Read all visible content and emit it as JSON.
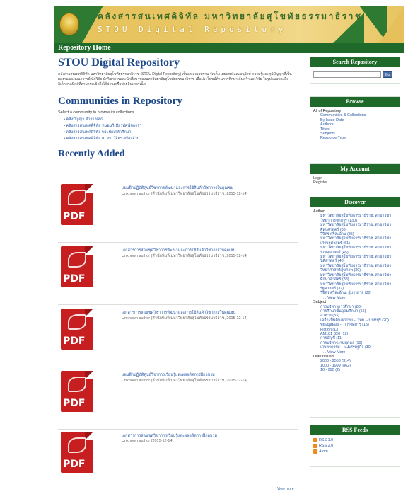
{
  "header": {
    "thai_title": "คลังสารสนเทศดิจิทัล มหาวิทยาลัยสุโขทัยธรรมาธิราช",
    "english_title": "STOU Digital Repository",
    "nav_home": "Repository Home"
  },
  "main": {
    "title": "STOU Digital Repository",
    "intro": "คลังสารสนเทศดิจิทัล มหาวิทยาลัยสุโขทัยธรรมาธิราช (STOU Digital Repository) เป็นแหล่งรวบรวม จัดเก็บ เผยแพร่ และอนุรักษ์ ความรู้และภูมิปัญญาที่เป็นผลงานของคณาจารย์ นักวิจัย นักวิชาการและนักศึกษาของมหาวิทยาลัยสุโขทัยธรรมาธิราช เพื่อประโยชน์ด้านการศึกษา ค้นคว้าและวิจัย ในรูปแบบของสื่ออิเล็กทรอนิกส์ที่สามารถเข้าถึงได้ผ่านเครือข่ายอินเทอร์เน็ต",
    "communities_title": "Communities in Repository",
    "communities_note": "Select a community to browse its collections.",
    "communities": [
      "คลังปัญญา ตำรา มสธ.",
      "คลังสารสนเทศดิจิทัล หนอนวิเทียรทัศน์ของรา",
      "คลังสารสนเทศดิจิทัล พระปกเกล้าศึกษา",
      "คลังสารสนเทศดิจิทัล ศ. ดร. วิจิตร ศรีสะอ้าน"
    ],
    "recent_title": "Recently Added",
    "recent": [
      {
        "title": "แผนฝึกปฏิบัติศูนย์วิชาการพัฒนาและการใช้สินค้าวิชาการในคุณชน",
        "author": "Unknown author (สำนักพิมพ์ มหาวิทยาลัยสุโขทัยธรรมาธิราช, 2015-12-14)"
      },
      {
        "title": "เอกสารการสอนชุดวิชาการพัฒนาและการใช้สินค้าวิชาการในคุณชน",
        "author": "Unknown author (สำนักพิมพ์ มหาวิทยาลัยสุโขทัยธรรมาธิราช, 2015-12-14)"
      },
      {
        "title": "เอกสารการสอนชุดวิชาการพัฒนาและการใช้สินค้าวิชาการในคุณชน",
        "author": "Unknown author (สำนักพิมพ์ มหาวิทยาลัยสุโขทัยธรรมาธิราช, 2015-12-14)"
      },
      {
        "title": "แผนฝึกปฏิบัติศูนย์วิชาการเรียนรู้และผลผลิตการฝึกอบรม",
        "author": "Unknown author (สำนักพิมพ์ มหาวิทยาลัยสุโขทัยธรรมาธิราช, 2015-12-14)"
      },
      {
        "title": "เอกสารการสอนชุดวิชาการเรียนรู้และผลผลิตการฝึกอบรม",
        "author": "Unknown author (2015-12-14)"
      }
    ],
    "pdf_label": "PDF",
    "view_more": "View more"
  },
  "sidebar": {
    "search_title": "Search Repository",
    "search_button": "Go",
    "browse_title": "Browse",
    "browse_root": "All of Repository",
    "browse_items": [
      "Communities & Collections",
      "By Issue Date",
      "Authors",
      "Titles",
      "Subjects",
      "Resource Type"
    ],
    "account_title": "My Account",
    "account_items": [
      "Login",
      "Register"
    ],
    "discover_title": "Discover",
    "author_label": "Author",
    "authors": [
      "มหาวิทยาลัยสุโขทัยธรรมาธิราช. สาขาวิชาวิทยาการจัดการ (130)",
      "มหาวิทยาลัยสุโขทัยธรรมาธิราช. สาขาวิชาศิลปศาสตร์ (86)",
      "วิจิตร ศรีสะอ้าน (85)",
      "มหาวิทยาลัยสุโขทัยธรรมาธิราช. สาขาวิชาเศรษฐศาสตร์ (61)",
      "มหาวิทยาลัยสุโขทัยธรรมาธิราช. สาขาวิชานิเทศศาสตร์ (45)",
      "มหาวิทยาลัยสุโขทัยธรรมาธิราช. สาขาวิชานิติศาสตร์ (40)",
      "มหาวิทยาลัยสุโขทัยธรรมาธิราช. สาขาวิชาวิทยาศาสตร์สุขภาพ (39)",
      "มหาวิทยาลัยสุโขทัยธรรมาธิราช. สาขาวิชาศึกษาศาสตร์ (38)",
      "มหาวิทยาลัยสุโขทัยธรรมาธิราช. สาขาวิชารัฐศาสตร์ (37)",
      "วิจิตร ศรีสะอ้าน, ผู้บรรยาย (30)"
    ],
    "subject_label": "Subject",
    "subjects": [
      "การบริหารการศึกษา (88)",
      "การศึกษาขั้นอุดมศึกษา (56)",
      "อาหาร (33)",
      "เครื่องปั้นดินเผาไทย -- ไทย -- นนทบุรี (20)",
      "ขยะมูลฝอย -- การจัดการ (15)",
      "Fiction (13)",
      "AM181 B26 (12)",
      "การบัญชี (11)",
      "การบริหารงานบุคคล (10)",
      "เกษตรกรรม -- แง่เศรษฐกิจ (10)"
    ],
    "date_label": "Date Issued",
    "dates": [
      "2000 - 2558 (314)",
      "1000 - 1999 (862)",
      "10 - 990 (2)"
    ],
    "view_more": "... View More",
    "rss_title": "RSS Feeds",
    "rss_items": [
      "RSS 1.0",
      "RSS 2.0",
      "Atom"
    ]
  }
}
